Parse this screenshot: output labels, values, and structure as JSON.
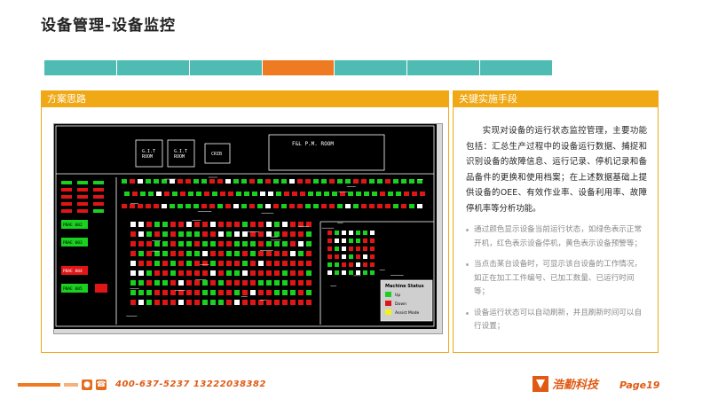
{
  "header": {
    "title": "设备管理-设备监控"
  },
  "stepbar": {
    "count": 7,
    "active_index": 3
  },
  "left_panel": {
    "title": "方案思路",
    "map": {
      "rooms": {
        "g1": "G.I.T",
        "g1b": "ROOM",
        "g2": "G.I.T",
        "g2b": "ROOM",
        "crib": "CRIB",
        "fsl": "F&L P.M. ROOM"
      },
      "machine_labels": [
        "PBAE 002",
        "PBAE 003",
        "PBAE 004",
        "PBAE 005"
      ],
      "legend": {
        "title": "Machine Status",
        "up": "Up",
        "down": "Down",
        "assist": "Assist Mode"
      },
      "colors": {
        "up": "#19d11e",
        "down": "#e01616",
        "assist": "#f2f21a"
      }
    }
  },
  "right_panel": {
    "title": "关键实施手段",
    "intro": "实现对设备的运行状态监控管理，主要功能包括：汇总生产过程中的设备运行数据、捕捉和识别设备的故障信息、运行记录、停机记录和备品备件的更换和使用档案；在上述数据基础上提供设备的OEE、有效作业率、设备利用率、故障停机率等分析功能。",
    "bullets": [
      "通过颜色显示设备当前运行状态，如绿色表示正常开机，红色表示设备停机，黄色表示设备预警等；",
      "当点击某台设备时，可显示该台设备的工作情况，如正在加工工件编号、已加工数量、已运行时间等；",
      "设备运行状态可以自动刷新，并且刷新时间可以自行设置；"
    ]
  },
  "footer": {
    "phone": "400-637-5237  13222038382",
    "logo_text": "浩勤科技",
    "page": "Page19"
  },
  "accent_colors": {
    "orange": "#ee7a21",
    "teal": "#4fbcb4",
    "gold": "#f0a814"
  }
}
